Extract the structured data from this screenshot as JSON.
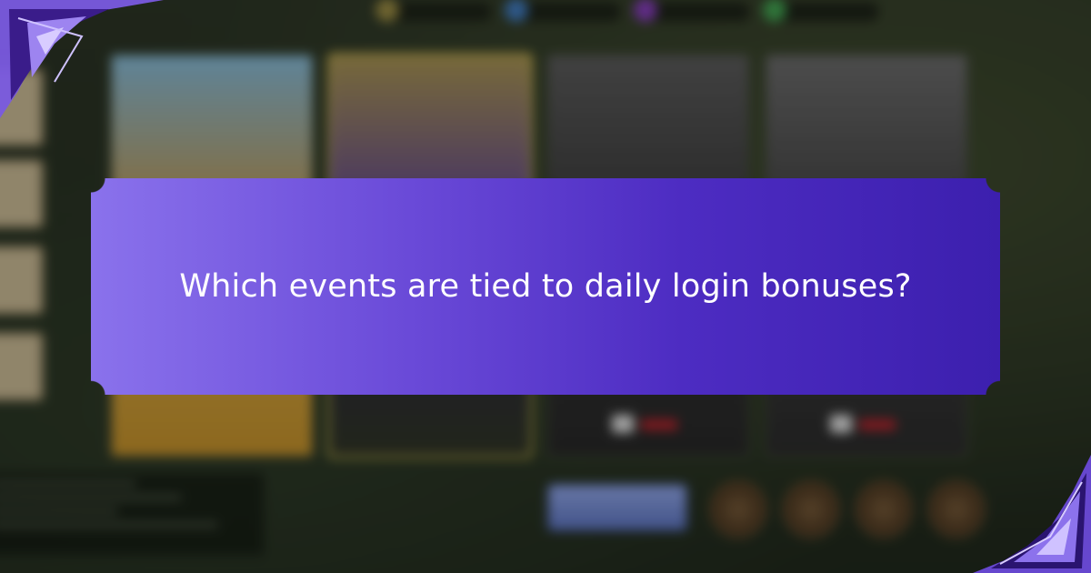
{
  "banner": {
    "question": "Which events are tied to daily login bonuses?"
  },
  "colors": {
    "banner_start": "#8a72ec",
    "banner_end": "#3c1fae",
    "banner_text": "#ffffff",
    "selected_card_border": "#c7b441"
  },
  "game_screen": {
    "cards": [
      {
        "title": "",
        "art": "hero-art",
        "selected": false,
        "locked": false,
        "footer": ""
      },
      {
        "title": "",
        "art": "dragon-art",
        "selected": true,
        "locked": false,
        "footer": ""
      },
      {
        "title": "",
        "art": "lost-realm-art",
        "selected": false,
        "locked": true,
        "footer": ""
      },
      {
        "title": "",
        "art": "forgotten-land-art",
        "selected": false,
        "locked": true,
        "footer": ""
      }
    ],
    "enter_label": "",
    "side_tabs": [
      {
        "label": ""
      },
      {
        "label": ""
      },
      {
        "label": ""
      },
      {
        "label": ""
      }
    ]
  },
  "icons": [
    "corner-crystal-icon",
    "lock-icon",
    "gem-icon",
    "chest-icon"
  ]
}
